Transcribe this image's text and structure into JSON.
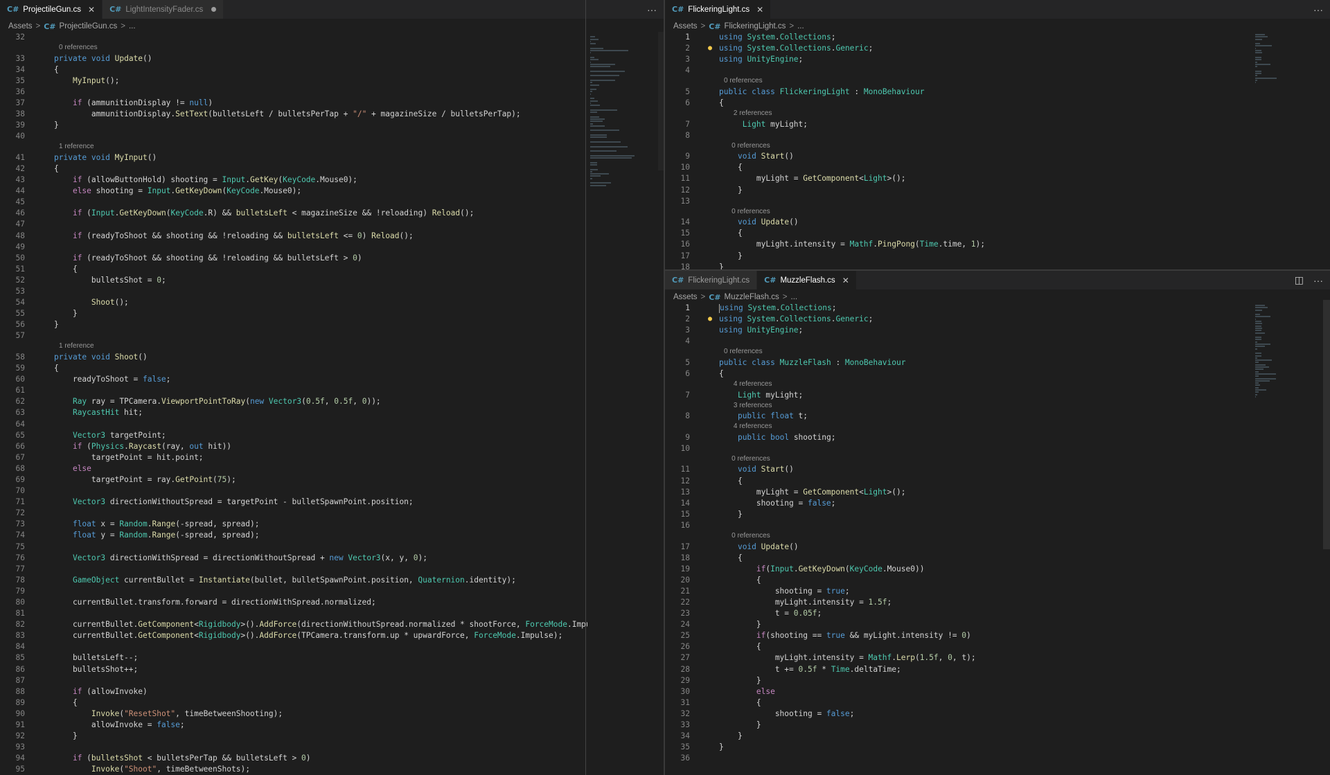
{
  "left": {
    "tabs": [
      {
        "label": "ProjectileGun.cs",
        "icon": "C#",
        "state": "active",
        "close": "✕"
      },
      {
        "label": "LightIntensityFader.cs",
        "icon": "C#",
        "state": "dirty"
      }
    ],
    "more": "···",
    "breadcrumb": {
      "folder": "Assets",
      "sep": ">",
      "icon": "C#",
      "file": "ProjectileGun.cs",
      "more": "..."
    }
  },
  "topright": {
    "tabs": [
      {
        "label": "FlickeringLight.cs",
        "icon": "C#",
        "state": "active",
        "close": "✕"
      }
    ],
    "more": "···",
    "breadcrumb": {
      "folder": "Assets",
      "sep": ">",
      "icon": "C#",
      "file": "FlickeringLight.cs",
      "more": "..."
    }
  },
  "bottomright": {
    "tabs": [
      {
        "label": "FlickeringLight.cs",
        "icon": "C#",
        "state": "inactive"
      },
      {
        "label": "MuzzleFlash.cs",
        "icon": "C#",
        "state": "active",
        "close": "✕"
      }
    ],
    "split_icon": "◫",
    "more": "···",
    "breadcrumb": {
      "folder": "Assets",
      "sep": ">",
      "icon": "C#",
      "file": "MuzzleFlash.cs",
      "more": "..."
    }
  },
  "colors": {
    "keyword": "#569cd6",
    "control": "#c586c0",
    "type": "#4ec9b0",
    "function": "#dcdcaa",
    "string": "#ce9178",
    "number": "#b5cea8",
    "editor_bg": "#1e1e1e"
  },
  "code": {
    "projectile_gun": [
      {
        "n": "32",
        "t": ""
      },
      {
        "lens": "0 references"
      },
      {
        "n": "33",
        "t": "private void Update()"
      },
      {
        "n": "34",
        "t": "{"
      },
      {
        "n": "35",
        "t": "    MyInput();"
      },
      {
        "n": "36",
        "t": ""
      },
      {
        "n": "37",
        "t": "    if (ammunitionDisplay != null)"
      },
      {
        "n": "38",
        "t": "        ammunitionDisplay.SetText(bulletsLeft / bulletsPerTap + \"/\" + magazineSize / bulletsPerTap);"
      },
      {
        "n": "39",
        "t": "}"
      },
      {
        "n": "40",
        "t": ""
      },
      {
        "lens": "1 reference"
      },
      {
        "n": "41",
        "t": "private void MyInput()"
      },
      {
        "n": "42",
        "t": "{"
      },
      {
        "n": "43",
        "t": "    if (allowButtonHold) shooting = Input.GetKey(KeyCode.Mouse0);"
      },
      {
        "n": "44",
        "t": "    else shooting = Input.GetKeyDown(KeyCode.Mouse0);"
      },
      {
        "n": "45",
        "t": ""
      },
      {
        "n": "46",
        "t": "    if (Input.GetKeyDown(KeyCode.R) && bulletsLeft < magazineSize && !reloading) Reload();"
      },
      {
        "n": "47",
        "t": ""
      },
      {
        "n": "48",
        "t": "    if (readyToShoot && shooting && !reloading && bulletsLeft <= 0) Reload();"
      },
      {
        "n": "49",
        "t": ""
      },
      {
        "n": "50",
        "t": "    if (readyToShoot && shooting && !reloading && bulletsLeft > 0)"
      },
      {
        "n": "51",
        "t": "    {"
      },
      {
        "n": "52",
        "t": "        bulletsShot = 0;"
      },
      {
        "n": "53",
        "t": ""
      },
      {
        "n": "54",
        "t": "        Shoot();"
      },
      {
        "n": "55",
        "t": "    }"
      },
      {
        "n": "56",
        "t": "}"
      },
      {
        "n": "57",
        "t": ""
      },
      {
        "lens": "1 reference"
      },
      {
        "n": "58",
        "t": "private void Shoot()"
      },
      {
        "n": "59",
        "t": "{"
      },
      {
        "n": "60",
        "t": "    readyToShoot = false;"
      },
      {
        "n": "61",
        "t": ""
      },
      {
        "n": "62",
        "t": "    Ray ray = TPCamera.ViewportPointToRay(new Vector3(0.5f, 0.5f, 0));"
      },
      {
        "n": "63",
        "t": "    RaycastHit hit;"
      },
      {
        "n": "64",
        "t": ""
      },
      {
        "n": "65",
        "t": "    Vector3 targetPoint;"
      },
      {
        "n": "66",
        "t": "    if (Physics.Raycast(ray, out hit))"
      },
      {
        "n": "67",
        "t": "        targetPoint = hit.point;"
      },
      {
        "n": "68",
        "t": "    else"
      },
      {
        "n": "69",
        "t": "        targetPoint = ray.GetPoint(75);"
      },
      {
        "n": "70",
        "t": ""
      },
      {
        "n": "71",
        "t": "    Vector3 directionWithoutSpread = targetPoint - bulletSpawnPoint.position;"
      },
      {
        "n": "72",
        "t": ""
      },
      {
        "n": "73",
        "t": "    float x = Random.Range(-spread, spread);"
      },
      {
        "n": "74",
        "t": "    float y = Random.Range(-spread, spread);"
      },
      {
        "n": "75",
        "t": ""
      },
      {
        "n": "76",
        "t": "    Vector3 directionWithSpread = directionWithoutSpread + new Vector3(x, y, 0);"
      },
      {
        "n": "77",
        "t": ""
      },
      {
        "n": "78",
        "t": "    GameObject currentBullet = Instantiate(bullet, bulletSpawnPoint.position, Quaternion.identity);"
      },
      {
        "n": "79",
        "t": ""
      },
      {
        "n": "80",
        "t": "    currentBullet.transform.forward = directionWithSpread.normalized;"
      },
      {
        "n": "81",
        "t": ""
      },
      {
        "n": "82",
        "t": "    currentBullet.GetComponent<Rigidbody>().AddForce(directionWithoutSpread.normalized * shootForce, ForceMode.Impul"
      },
      {
        "n": "83",
        "t": "    currentBullet.GetComponent<Rigidbody>().AddForce(TPCamera.transform.up * upwardForce, ForceMode.Impulse);"
      },
      {
        "n": "84",
        "t": ""
      },
      {
        "n": "85",
        "t": "    bulletsLeft--;"
      },
      {
        "n": "86",
        "t": "    bulletsShot++;"
      },
      {
        "n": "87",
        "t": ""
      },
      {
        "n": "88",
        "t": "    if (allowInvoke)"
      },
      {
        "n": "89",
        "t": "    {"
      },
      {
        "n": "90",
        "t": "        Invoke(\"ResetShot\", timeBetweenShooting);"
      },
      {
        "n": "91",
        "t": "        allowInvoke = false;"
      },
      {
        "n": "92",
        "t": "    }"
      },
      {
        "n": "93",
        "t": ""
      },
      {
        "n": "94",
        "t": "    if (bulletsShot < bulletsPerTap && bulletsLeft > 0)"
      },
      {
        "n": "95",
        "t": "        Invoke(\"Shoot\", timeBetweenShots);"
      }
    ],
    "flickering_light": [
      {
        "n": "1",
        "t": "using System.Collections;",
        "cur": true
      },
      {
        "n": "2",
        "t": "using System.Collections.Generic;",
        "bulb": true
      },
      {
        "n": "3",
        "t": "using UnityEngine;"
      },
      {
        "n": "4",
        "t": ""
      },
      {
        "lens": "0 references"
      },
      {
        "n": "5",
        "t": "public class FlickeringLight : MonoBehaviour"
      },
      {
        "n": "6",
        "t": "{"
      },
      {
        "lens": "     2 references"
      },
      {
        "n": "7",
        "t": "     Light myLight;"
      },
      {
        "n": "8",
        "t": ""
      },
      {
        "lens": "    0 references"
      },
      {
        "n": "9",
        "t": "    void Start()"
      },
      {
        "n": "10",
        "t": "    {"
      },
      {
        "n": "11",
        "t": "        myLight = GetComponent<Light>();"
      },
      {
        "n": "12",
        "t": "    }"
      },
      {
        "n": "13",
        "t": ""
      },
      {
        "lens": "    0 references"
      },
      {
        "n": "14",
        "t": "    void Update()"
      },
      {
        "n": "15",
        "t": "    {"
      },
      {
        "n": "16",
        "t": "        myLight.intensity = Mathf.PingPong(Time.time, 1);"
      },
      {
        "n": "17",
        "t": "    }"
      },
      {
        "n": "18",
        "t": "}"
      }
    ],
    "muzzle_flash": [
      {
        "n": "1",
        "t": "using System.Collections;",
        "cur": true,
        "caret": true
      },
      {
        "n": "2",
        "t": "using System.Collections.Generic;",
        "bulb": true
      },
      {
        "n": "3",
        "t": "using UnityEngine;"
      },
      {
        "n": "4",
        "t": ""
      },
      {
        "lens": "0 references"
      },
      {
        "n": "5",
        "t": "public class MuzzleFlash : MonoBehaviour"
      },
      {
        "n": "6",
        "t": "{"
      },
      {
        "lens": "     4 references"
      },
      {
        "n": "7",
        "t": "    Light myLight;"
      },
      {
        "lens": "     3 references"
      },
      {
        "n": "8",
        "t": "    public float t;"
      },
      {
        "lens": "     4 references"
      },
      {
        "n": "9",
        "t": "    public bool shooting;"
      },
      {
        "n": "10",
        "t": ""
      },
      {
        "lens": "    0 references"
      },
      {
        "n": "11",
        "t": "    void Start()"
      },
      {
        "n": "12",
        "t": "    {"
      },
      {
        "n": "13",
        "t": "        myLight = GetComponent<Light>();"
      },
      {
        "n": "14",
        "t": "        shooting = false;"
      },
      {
        "n": "15",
        "t": "    }"
      },
      {
        "n": "16",
        "t": ""
      },
      {
        "lens": "    0 references"
      },
      {
        "n": "17",
        "t": "    void Update()"
      },
      {
        "n": "18",
        "t": "    {"
      },
      {
        "n": "19",
        "t": "        if(Input.GetKeyDown(KeyCode.Mouse0))"
      },
      {
        "n": "20",
        "t": "        {"
      },
      {
        "n": "21",
        "t": "            shooting = true;"
      },
      {
        "n": "22",
        "t": "            myLight.intensity = 1.5f;"
      },
      {
        "n": "23",
        "t": "            t = 0.05f;"
      },
      {
        "n": "24",
        "t": "        }"
      },
      {
        "n": "25",
        "t": "        if(shooting == true && myLight.intensity != 0)"
      },
      {
        "n": "26",
        "t": "        {"
      },
      {
        "n": "27",
        "t": "            myLight.intensity = Mathf.Lerp(1.5f, 0, t);"
      },
      {
        "n": "28",
        "t": "            t += 0.5f * Time.deltaTime;"
      },
      {
        "n": "29",
        "t": "        }"
      },
      {
        "n": "30",
        "t": "        else"
      },
      {
        "n": "31",
        "t": "        {"
      },
      {
        "n": "32",
        "t": "            shooting = false;"
      },
      {
        "n": "33",
        "t": "        }"
      },
      {
        "n": "34",
        "t": "    }"
      },
      {
        "n": "35",
        "t": "}"
      },
      {
        "n": "36",
        "t": ""
      }
    ]
  }
}
